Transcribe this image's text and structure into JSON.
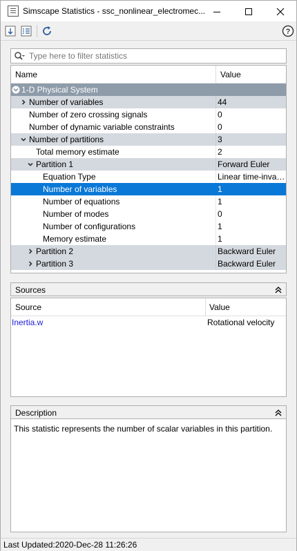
{
  "window": {
    "title": "Simscape Statistics - ssc_nonlinear_electromec...",
    "icon": "statistics-window-icon"
  },
  "toolbar": {
    "buttons": [
      {
        "icon": "expand-all-icon"
      },
      {
        "icon": "list-details-icon"
      },
      {
        "icon": "refresh-icon"
      },
      {
        "icon": "help-icon"
      }
    ]
  },
  "filter": {
    "placeholder": "Type here to filter statistics"
  },
  "statistics": {
    "columns": {
      "name": "Name",
      "value": "Value"
    },
    "rows": [
      {
        "name": "1-D Physical System",
        "value": "",
        "level": 0,
        "toggle": "collapse",
        "style": "system"
      },
      {
        "name": "Number of variables",
        "value": "44",
        "level": 1,
        "toggle": "expand",
        "style": "group"
      },
      {
        "name": "Number of zero crossing signals",
        "value": "0",
        "level": 1,
        "toggle": "",
        "style": "plain"
      },
      {
        "name": "Number of dynamic variable constraints",
        "value": "0",
        "level": 1,
        "toggle": "",
        "style": "plain"
      },
      {
        "name": "Number of partitions",
        "value": "3",
        "level": 1,
        "toggle": "collapse",
        "style": "group"
      },
      {
        "name": "Total memory estimate",
        "value": "2",
        "level": 2,
        "toggle": "",
        "style": "plain"
      },
      {
        "name": "Partition 1",
        "value": "Forward Euler",
        "level": 2,
        "toggle": "collapse",
        "style": "group"
      },
      {
        "name": "Equation Type",
        "value": "Linear time-invariant",
        "level": 3,
        "toggle": "",
        "style": "plain"
      },
      {
        "name": "Number of variables",
        "value": "1",
        "level": 3,
        "toggle": "",
        "style": "selected"
      },
      {
        "name": "Number of equations",
        "value": "1",
        "level": 3,
        "toggle": "",
        "style": "plain"
      },
      {
        "name": "Number of modes",
        "value": "0",
        "level": 3,
        "toggle": "",
        "style": "plain"
      },
      {
        "name": "Number of configurations",
        "value": "1",
        "level": 3,
        "toggle": "",
        "style": "plain"
      },
      {
        "name": "Memory estimate",
        "value": "1",
        "level": 3,
        "toggle": "",
        "style": "plain"
      },
      {
        "name": "Partition 2",
        "value": "Backward Euler",
        "level": 2,
        "toggle": "expand",
        "style": "group"
      },
      {
        "name": "Partition 3",
        "value": "Backward Euler",
        "level": 2,
        "toggle": "expand",
        "style": "group"
      }
    ]
  },
  "sources": {
    "title": "Sources",
    "collapse_glyph": "≈",
    "columns": {
      "source": "Source",
      "value": "Value"
    },
    "rows": [
      {
        "source": "Inertia.w",
        "value": "Rotational velocity"
      }
    ]
  },
  "description": {
    "title": "Description",
    "collapse_glyph": "≈",
    "text": "This statistic represents the number of scalar variables in this partition."
  },
  "status": {
    "text": "Last Updated:2020-Dec-28 11:26:26"
  }
}
